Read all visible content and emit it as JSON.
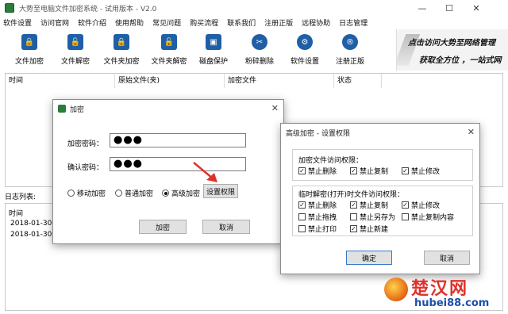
{
  "window": {
    "title": "大势至电脑文件加密系统 - 试用版本 - V2.0",
    "minimize": "—",
    "maximize": "☐",
    "close": "✕"
  },
  "menu": [
    "软件设置",
    "访问官网",
    "软件介绍",
    "使用帮助",
    "常见问题",
    "购买流程",
    "联系我们",
    "注册正版",
    "远程协助",
    "日志管理"
  ],
  "toolbar": [
    {
      "label": "文件加密",
      "icon": "file-lock-icon"
    },
    {
      "label": "文件解密",
      "icon": "file-unlock-icon"
    },
    {
      "label": "文件夹加密",
      "icon": "folder-lock-icon"
    },
    {
      "label": "文件夹解密",
      "icon": "folder-unlock-icon"
    },
    {
      "label": "磁盘保护",
      "icon": "disk-protect-icon"
    },
    {
      "label": "粉碎删除",
      "icon": "shred-icon"
    },
    {
      "label": "软件设置",
      "icon": "gear-icon"
    },
    {
      "label": "注册正版",
      "icon": "register-icon"
    }
  ],
  "banner": {
    "line1": "点击访问大势至网络管理",
    "line2": "获取全方位 ，一站式网"
  },
  "table": {
    "columns": [
      "时间",
      "原始文件(夹)",
      "加密文件",
      "状态"
    ]
  },
  "log": {
    "label": "日志列表:",
    "time_header": "时间",
    "rows": [
      "2018-01-30 17",
      "2018-01-30 17"
    ]
  },
  "encrypt_dialog": {
    "title": "加密",
    "password_label": "加密密码：",
    "password_value": "●●●",
    "confirm_label": "确认密码：",
    "confirm_value": "●●●",
    "modes": [
      {
        "label": "移动加密",
        "selected": false
      },
      {
        "label": "普通加密",
        "selected": false
      },
      {
        "label": "高级加密",
        "selected": true
      }
    ],
    "set_permissions_button": "设置权限",
    "ok_button": "加密",
    "cancel_button": "取消"
  },
  "permissions_dialog": {
    "title": "高级加密 - 设置权限",
    "group1_title": "加密文件访问权限：",
    "group1": [
      {
        "label": "禁止删除",
        "checked": true
      },
      {
        "label": "禁止复制",
        "checked": true
      },
      {
        "label": "禁止修改",
        "checked": true
      }
    ],
    "group2_title": "临时解密(打开)时文件访问权限：",
    "group2": [
      {
        "label": "禁止删除",
        "checked": true
      },
      {
        "label": "禁止复制",
        "checked": true
      },
      {
        "label": "禁止修改",
        "checked": true
      },
      {
        "label": "禁止拖拽",
        "checked": false
      },
      {
        "label": "禁止另存为",
        "checked": false
      },
      {
        "label": "禁止复制内容",
        "checked": false
      },
      {
        "label": "禁止打印",
        "checked": false
      },
      {
        "label": "禁止新建",
        "checked": true
      }
    ],
    "ok_button": "确定",
    "cancel_button": "取消"
  },
  "watermark": {
    "name": "楚汉网",
    "url": "hubei88.com"
  },
  "colors": {
    "icon_blue": "#1f5fa8",
    "arrow_red": "#e0322b",
    "watermark_red": "#e0322b",
    "watermark_blue": "#1c4fa8"
  }
}
